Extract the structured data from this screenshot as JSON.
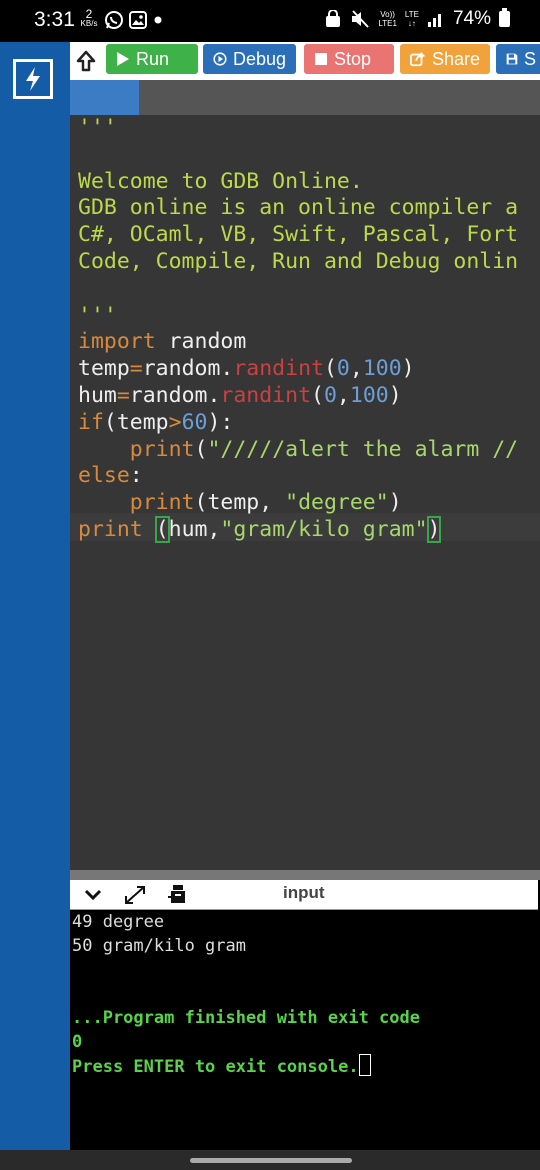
{
  "status_bar": {
    "time": "3:31",
    "data_speed": "2",
    "data_unit": "KB/s",
    "network_label": "LTE",
    "volte_top": "Vo))",
    "volte_bottom": "LTE1",
    "battery": "74%"
  },
  "toolbar": {
    "run_label": "Run",
    "debug_label": "Debug",
    "stop_label": "Stop",
    "share_label": "Share",
    "save_label": "S"
  },
  "editor": {
    "comment_open": "'''",
    "welcome_lines": [
      "Welcome to GDB Online.",
      "GDB online is an online compiler a",
      "C#, OCaml, VB, Swift, Pascal, Fort",
      "Code, Compile, Run and Debug onlin"
    ],
    "comment_close": "'''",
    "code": {
      "l1_kw": "import",
      "l1_rest": " random",
      "l2_var": "temp",
      "l2_eq": "=",
      "l2_obj": "random.",
      "l2_fn": "randint",
      "l2_open": "(",
      "l2_a": "0",
      "l2_comma": ",",
      "l2_b": "100",
      "l2_close": ")",
      "l3_var": "hum",
      "l3_eq": "=",
      "l3_obj": "random.",
      "l3_fn": "randint",
      "l3_open": "(",
      "l3_a": "0",
      "l3_comma": ",",
      "l3_b": "100",
      "l3_close": ")",
      "l4_kw": "if",
      "l4_open": "(",
      "l4_var": "temp",
      "l4_op": ">",
      "l4_num": "60",
      "l4_close": "):",
      "l5_indent": "    ",
      "l5_kw": "print",
      "l5_open": "(",
      "l5_str": "\"/////alert the alarm //",
      "l6_kw": "else",
      "l6_colon": ":",
      "l7_indent": "    ",
      "l7_kw": "print",
      "l7_args": "(temp, ",
      "l7_str": "\"degree\"",
      "l7_close": ")",
      "l8_kw": "print",
      "l8_sp": " ",
      "l8_open": "(",
      "l8_args": "hum,",
      "l8_str": "\"gram/kilo gram\"",
      "l8_close": ")"
    }
  },
  "console": {
    "tab_label": "input",
    "output_lines": [
      "49 degree",
      "50 gram/kilo gram"
    ],
    "finished_line": "...Program finished with exit code",
    "exit_code": "0",
    "press_enter": "Press ENTER to exit console."
  }
}
